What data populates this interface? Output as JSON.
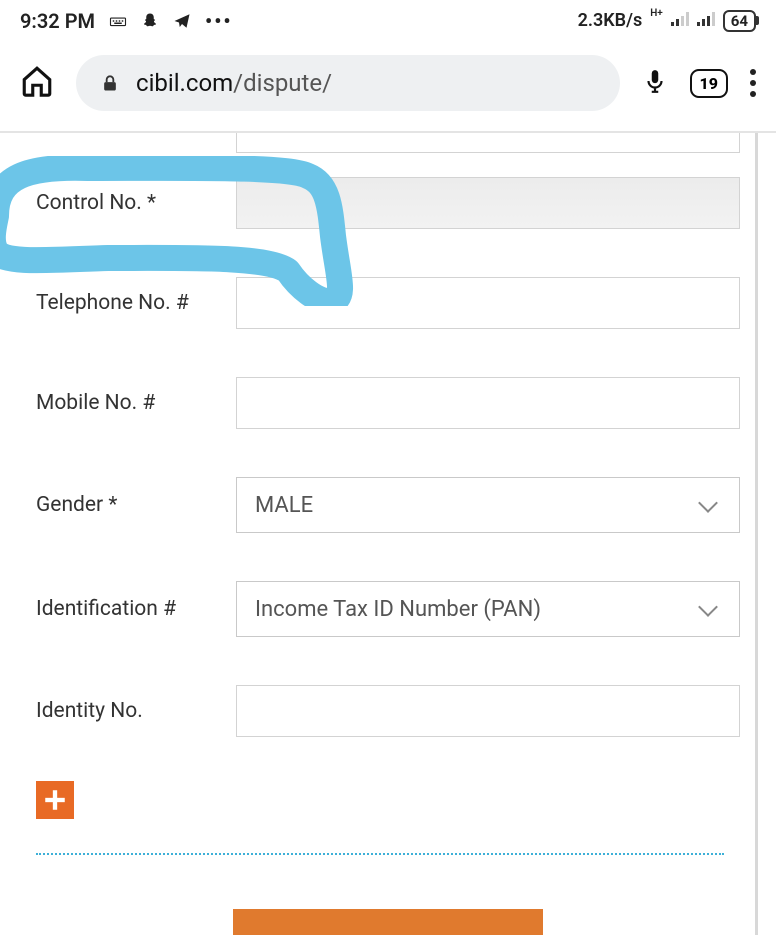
{
  "status": {
    "time": "9:32 PM",
    "data_rate": "2.3KB/s",
    "network_label": "H+",
    "battery_pct": "64"
  },
  "browser": {
    "url_domain": "cibil.com",
    "url_path": "/dispute/",
    "tab_count": "19"
  },
  "form": {
    "control_no": {
      "label": "Control No. *",
      "value": ""
    },
    "telephone": {
      "label": "Telephone No. #",
      "value": ""
    },
    "mobile": {
      "label": "Mobile No. #",
      "value": ""
    },
    "gender": {
      "label": "Gender *",
      "value": "MALE"
    },
    "identification": {
      "label": "Identification #",
      "value": "Income Tax ID Number (PAN)"
    },
    "identity_no": {
      "label": "Identity No.",
      "value": ""
    }
  },
  "icons": {
    "add": "plus-icon"
  }
}
